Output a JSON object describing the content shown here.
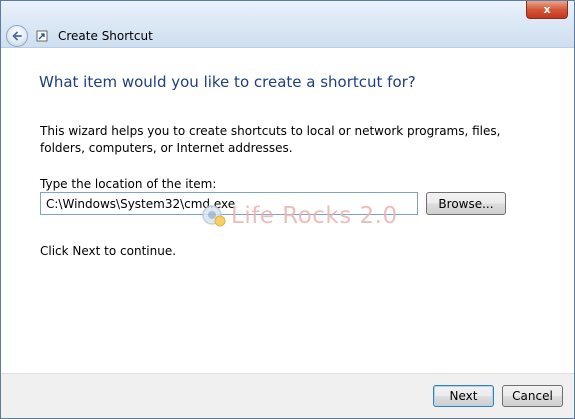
{
  "window": {
    "title": "Create Shortcut",
    "close_glyph": "x",
    "back_icon": "back-arrow-icon",
    "wizard_icon": "shortcut-wizard-icon"
  },
  "main": {
    "heading": "What item would you like to create a shortcut for?",
    "description": "This wizard helps you to create shortcuts to local or network programs, files, folders, computers, or Internet addresses.",
    "location_label": "Type the location of the item:",
    "location_value": "C:\\Windows\\System32\\cmd.exe",
    "browse_label": "Browse...",
    "continue_text": "Click Next to continue."
  },
  "watermark": {
    "text": "Life Rocks 2.0"
  },
  "footer": {
    "next_label": "Next",
    "cancel_label": "Cancel"
  },
  "colors": {
    "heading": "#1e3e86",
    "close_button": "#c2391c",
    "default_button_border": "#3c7fb1"
  }
}
